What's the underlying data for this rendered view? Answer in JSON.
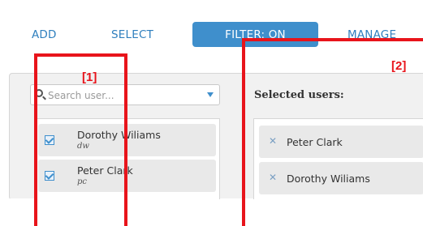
{
  "nav": {
    "add_label": "ADD",
    "select_label": "SELECT",
    "filter_label": "FILTER: ON",
    "manage_label": "MANAGE"
  },
  "search": {
    "placeholder": "Search user..."
  },
  "available_users": [
    {
      "name": "Dorothy Wiliams",
      "handle": "dw",
      "checked": true
    },
    {
      "name": "Peter Clark",
      "handle": "pc",
      "checked": true
    }
  ],
  "selected": {
    "title": "Selected users:",
    "items": [
      {
        "name": "Peter Clark"
      },
      {
        "name": "Dorothy Wiliams"
      }
    ]
  },
  "annotations": {
    "label_1": "[1]",
    "label_2": "[2]"
  },
  "colors": {
    "accent": "#3f8fcc",
    "annotation": "#e8141b"
  }
}
